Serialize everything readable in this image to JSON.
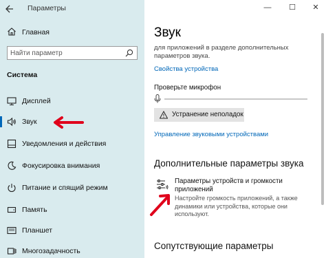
{
  "window": {
    "title": "Параметры",
    "minimize": "—",
    "maximize": "☐",
    "close": "✕"
  },
  "sidebar": {
    "home_label": "Главная",
    "search_placeholder": "Найти параметр",
    "section_title": "Система",
    "items": [
      {
        "label": "Дисплей",
        "icon": "display-icon"
      },
      {
        "label": "Звук",
        "icon": "speaker-icon",
        "active": true
      },
      {
        "label": "Уведомления и действия",
        "icon": "notifications-icon"
      },
      {
        "label": "Фокусировка внимания",
        "icon": "focus-assist-icon"
      },
      {
        "label": "Питание и спящий режим",
        "icon": "power-icon"
      },
      {
        "label": "Память",
        "icon": "storage-icon"
      },
      {
        "label": "Планшет",
        "icon": "tablet-icon"
      },
      {
        "label": "Многозадачность",
        "icon": "multitasking-icon"
      }
    ]
  },
  "main": {
    "title": "Звук",
    "description": "для приложений в разделе дополнительных параметров звука.",
    "device_properties_link": "Свойства устройства",
    "mic_test_label": "Проверьте микрофон",
    "troubleshoot_button": "Устранение неполадок",
    "manage_devices_link": "Управление звуковыми устройствами",
    "advanced_heading": "Дополнительные параметры звука",
    "app_volume_title": "Параметры устройств и громкости приложений",
    "app_volume_desc": "Настройте громкость приложений, а также динамики или устройства, которые они используют.",
    "related_heading": "Сопутствующие параметры"
  },
  "colors": {
    "sidebar_bg": "#d9ebee",
    "accent": "#0067b8",
    "annotation_arrow": "#e0001b"
  }
}
